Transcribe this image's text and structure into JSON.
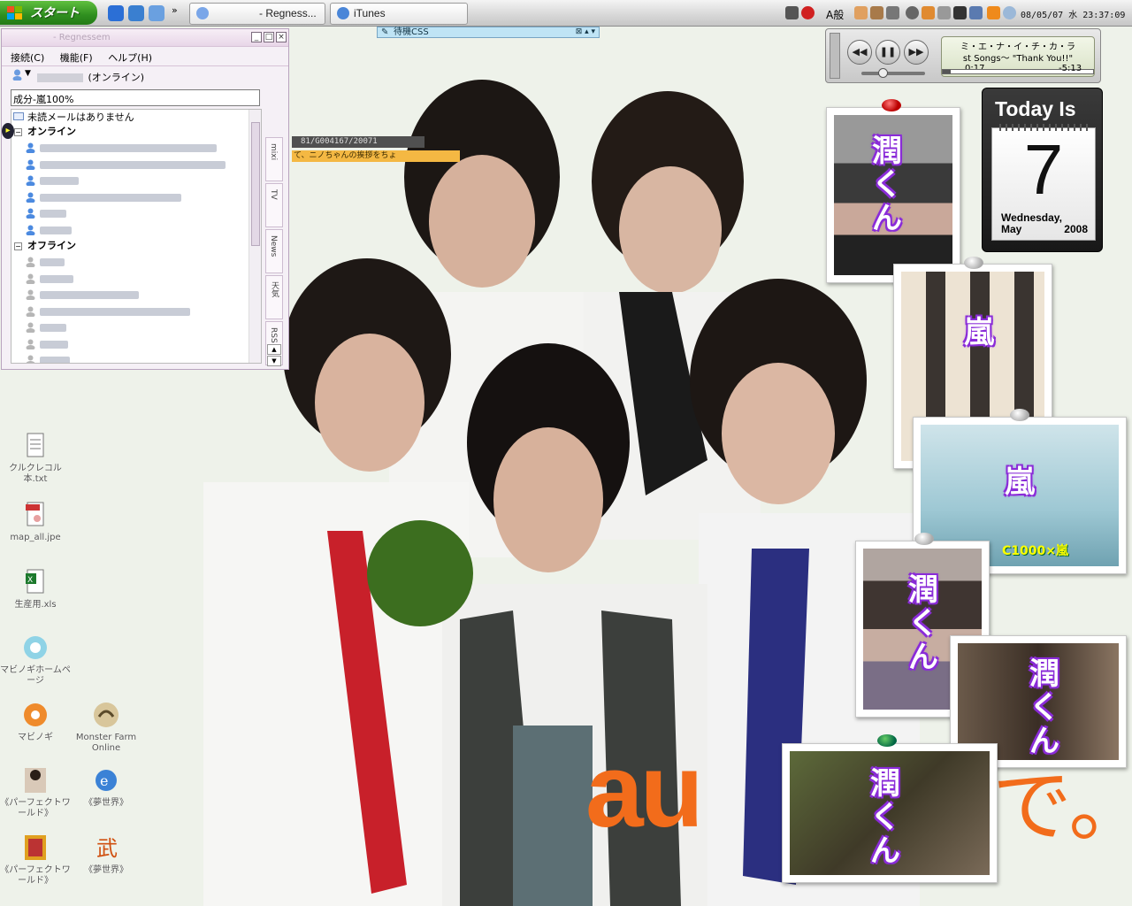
{
  "taskbar": {
    "start_label": "スタート",
    "tasks": [
      {
        "name": "task-regnessem",
        "label": "- Regness..."
      },
      {
        "name": "task-itunes",
        "label": "iTunes"
      }
    ],
    "ime_label": "A般",
    "clock": "08/05/07 水 23:37:09"
  },
  "messenger": {
    "title": "- Regnessem",
    "menu": [
      "接続(C)",
      "機能(F)",
      "ヘルプ(H)"
    ],
    "status": "(オンライン)",
    "personal_message": "成分-嵐100%",
    "mail_notice": "未読メールはありません",
    "groups": [
      {
        "label": "オンライン",
        "toggle": "−",
        "count": 6
      },
      {
        "label": "オフライン",
        "toggle": "−",
        "count": 7
      }
    ],
    "side_tabs": [
      "mixi",
      "TV",
      "News",
      "天気",
      "RSS"
    ]
  },
  "floating_bar": {
    "label": "待機CSS"
  },
  "wallpaper_text": {
    "url": "81/G004167/20071",
    "news": "て、ニノちゃんの挨拶をちょ",
    "brand": "au",
    "tail": "で。"
  },
  "itunes": {
    "title": "ミ・エ・ナ・イ・チ・カ・ラ",
    "subtitle": "st Songs〜 \"Thank You!!\"",
    "elapsed": "0:17",
    "remaining": "-5:13",
    "progress": 0.05,
    "volume": 0.3
  },
  "today_widget": {
    "title": "Today Is",
    "day": "7",
    "weekday": "Wednesday,",
    "month": "May",
    "year": "2008"
  },
  "photos": [
    {
      "name": "photo-jun-1",
      "caption": "潤くん"
    },
    {
      "name": "photo-arashi-1",
      "caption": "嵐"
    },
    {
      "name": "photo-arashi-2",
      "caption": "嵐",
      "banner": "C1000×嵐"
    },
    {
      "name": "photo-jun-2",
      "caption": "潤くん"
    },
    {
      "name": "photo-jun-3",
      "caption": "潤くん"
    },
    {
      "name": "photo-jun-4",
      "caption": "潤くん"
    }
  ],
  "desktop_icons": [
    {
      "name": "icon-txt-file",
      "label": "クルクレコル本.txt"
    },
    {
      "name": "icon-jpeg-file",
      "label": "map_all.jpe"
    },
    {
      "name": "icon-xls-file",
      "label": "生産用.xls"
    },
    {
      "name": "icon-mabinogi-home",
      "label": "マビノギホームページ"
    },
    {
      "name": "icon-mabinogi",
      "label": "マビノギ"
    },
    {
      "name": "icon-monster-farm",
      "label": "Monster Farm Online"
    },
    {
      "name": "icon-perfect-world-1",
      "label": "《パーフェクトワールド》"
    },
    {
      "name": "icon-yume-sekai-1",
      "label": "《夢世界》"
    },
    {
      "name": "icon-perfect-world-2",
      "label": "《パーフェクトワールド》"
    },
    {
      "name": "icon-yume-sekai-2",
      "label": "《夢世界》"
    }
  ]
}
